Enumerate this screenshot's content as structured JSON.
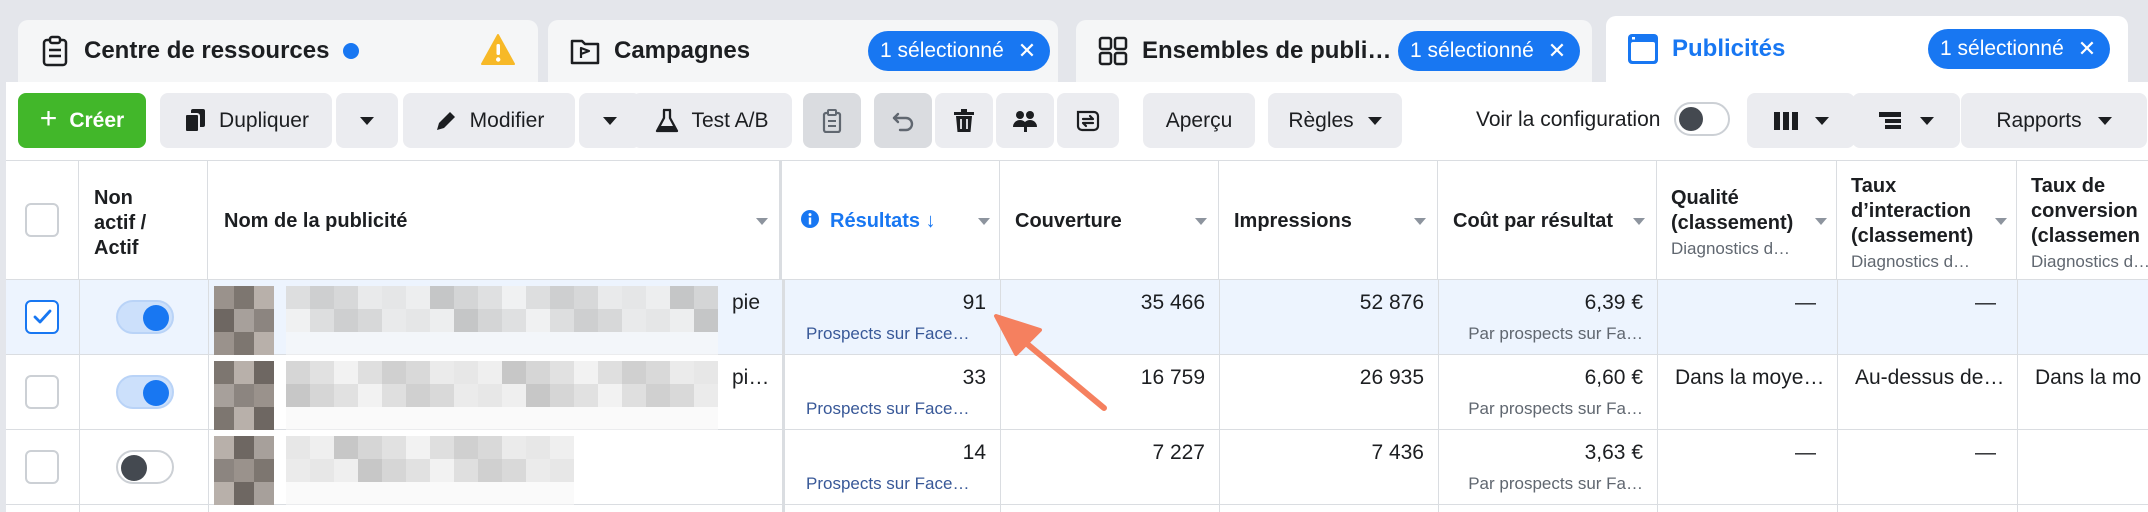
{
  "tabs": [
    {
      "title": "Centre de ressources",
      "icon": "clipboard-icon"
    },
    {
      "title": "Campagnes",
      "icon": "flag-folder-icon",
      "badge": "1 sélectionné"
    },
    {
      "title": "Ensembles de publici…",
      "icon": "grid-icon",
      "badge": "1 sélectionné"
    },
    {
      "title": "Publicités",
      "icon": "ad-window-icon",
      "badge": "1 sélectionné"
    }
  ],
  "toolbar": {
    "create": "Créer",
    "duplicate": "Dupliquer",
    "edit": "Modifier",
    "ab_test": "Test A/B",
    "preview": "Aperçu",
    "rules": "Règles",
    "view_config": "Voir la configuration",
    "reports": "Rapports"
  },
  "columns": {
    "status": "Non actif / Actif",
    "status_l1": "Non",
    "status_l2": "actif /",
    "status_l3": "Actif",
    "name": "Nom de la publicité",
    "results": "Résultats",
    "reach": "Couverture",
    "impressions": "Impressions",
    "cost": "Coût par résultat",
    "quality_l1": "Qualité",
    "quality_l2": "(classement)",
    "quality_sub": "Diagnostics d…",
    "engagement_l1": "Taux",
    "engagement_l2": "d’interaction",
    "engagement_l3": "(classement)",
    "engagement_sub": "Diagnostics d…",
    "conversion_l1": "Taux de",
    "conversion_l2": "conversion",
    "conversion_l3": "(classemen",
    "conversion_sub": "Diagnostics d…"
  },
  "rows": [
    {
      "selected": true,
      "active": true,
      "name_tail": "pie",
      "results": "91",
      "results_sub": "Prospects sur Face…",
      "reach": "35 466",
      "impressions": "52 876",
      "cost": "6,39 €",
      "cost_sub": "Par prospects sur Fa…",
      "quality": "—",
      "engagement": "—",
      "conversion": ""
    },
    {
      "selected": false,
      "active": true,
      "name_tail": "pi…",
      "results": "33",
      "results_sub": "Prospects sur Face…",
      "reach": "16 759",
      "impressions": "26 935",
      "cost": "6,60 €",
      "cost_sub": "Par prospects sur Fa…",
      "quality": "Dans la moye…",
      "engagement": "Au-dessus de…",
      "conversion": "Dans la mo"
    },
    {
      "selected": false,
      "active": false,
      "name_tail": "",
      "results": "14",
      "results_sub": "Prospects sur Face…",
      "reach": "7 227",
      "impressions": "7 436",
      "cost": "3,63 €",
      "cost_sub": "Par prospects sur Fa…",
      "quality": "—",
      "engagement": "—",
      "conversion": ""
    }
  ],
  "colors": {
    "accent": "#1877f2",
    "create": "#42b72a",
    "arrow": "#f5805f",
    "selected_row": "#edf4fe"
  }
}
